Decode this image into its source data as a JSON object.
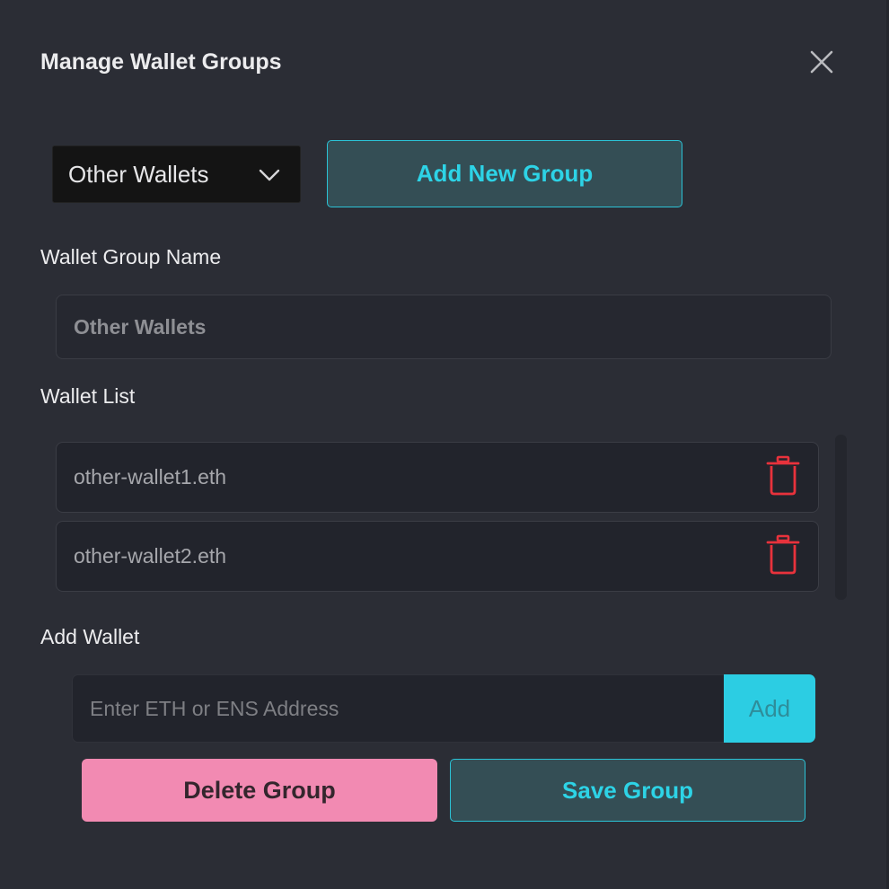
{
  "modal": {
    "title": "Manage Wallet Groups",
    "close_icon": "close-icon"
  },
  "group_selector": {
    "selected": "Other Wallets",
    "icon": "chevron-down-icon"
  },
  "add_new_group_label": "Add New Group",
  "group_name": {
    "label": "Wallet Group Name",
    "value": "Other Wallets"
  },
  "wallet_list": {
    "label": "Wallet List",
    "items": [
      {
        "address": "other-wallet1.eth",
        "icon": "trash-icon"
      },
      {
        "address": "other-wallet2.eth",
        "icon": "trash-icon"
      }
    ]
  },
  "add_wallet": {
    "label": "Add Wallet",
    "placeholder": "Enter ETH or ENS Address",
    "button_label": "Add"
  },
  "footer": {
    "delete_label": "Delete Group",
    "save_label": "Save Group"
  },
  "colors": {
    "background": "#2b2d35",
    "accent": "#2dd3e6",
    "danger": "#e8323c",
    "delete_button": "#f28ab2"
  }
}
